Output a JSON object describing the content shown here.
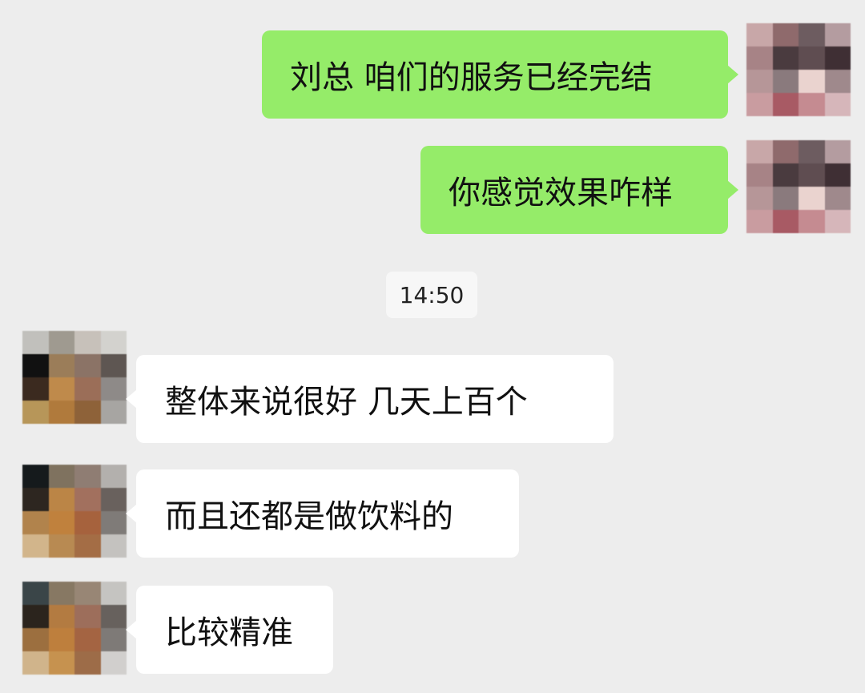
{
  "colors": {
    "background": "#ededed",
    "outgoing_bubble": "#95ec69",
    "incoming_bubble": "#ffffff",
    "timestamp_pill": "#f7f7f7"
  },
  "timestamp": "14:50",
  "messages": [
    {
      "side": "right",
      "text": "刘总 咱们的服务已经完结"
    },
    {
      "side": "right",
      "text": "你感觉效果咋样"
    },
    {
      "side": "left",
      "text": "整体来说很好 几天上百个"
    },
    {
      "side": "left",
      "text": "而且还都是做饮料的"
    },
    {
      "side": "left",
      "text": "比较精准"
    }
  ]
}
